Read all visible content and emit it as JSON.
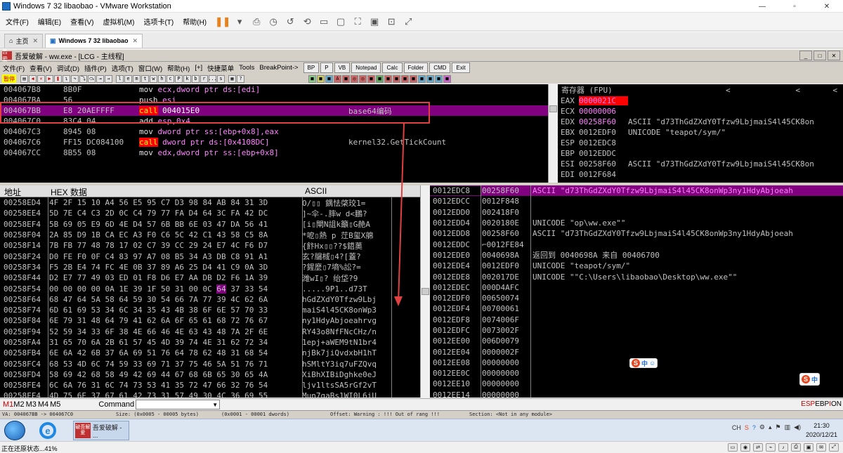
{
  "vm": {
    "title": "Windows 7 32 libaobao - VMware Workstation",
    "window_buttons": [
      "—",
      "▫",
      "✕"
    ],
    "menu": [
      "文件(F)",
      "编辑(E)",
      "查看(V)",
      "虚拟机(M)",
      "选项卡(T)",
      "帮助(H)"
    ],
    "tabs": [
      {
        "label": "主页"
      },
      {
        "label": "Windows 7 32 libaobao"
      }
    ]
  },
  "od": {
    "title": "吾爱破解 - ww.exe - [LCG - 主线程]",
    "icon_text": "吾爱",
    "menu": [
      "文件(F)",
      "查看(V)",
      "调试(D)",
      "插件(P)",
      "选项(T)",
      "窗口(W)",
      "帮助(H)",
      "[+]",
      "快捷菜单",
      "Tools",
      "BreakPoint->"
    ],
    "buttons": [
      "BP",
      "P",
      "VB",
      "Notepad",
      "Calc",
      "Folder",
      "CMD",
      "Exit"
    ],
    "paused": "暂停",
    "tool_letters": [
      "l",
      "e",
      "m",
      "t",
      "w",
      "h",
      "c",
      "P",
      "k",
      "b",
      "r",
      "...",
      "s"
    ]
  },
  "disasm": {
    "rows": [
      {
        "addr": "004067B8",
        "hex": "8B0F",
        "mn": "mov",
        "ops": "ecx,dword ptr ds:[edi]",
        "comment": ""
      },
      {
        "addr": "004067BA",
        "hex": "56",
        "mn": "push",
        "ops": "esi",
        "comment": ""
      },
      {
        "addr": "004067BB",
        "hex": "E8 20AEFFFF",
        "mn": "call",
        "ops": "004015E0",
        "comment": "base64编码",
        "selected": true
      },
      {
        "addr": "004067C0",
        "hex": "83C4 04",
        "mn": "add",
        "ops": "esp,0x4",
        "comment": ""
      },
      {
        "addr": "004067C3",
        "hex": "8945 08",
        "mn": "mov",
        "ops": "dword ptr ss:[ebp+0x8],eax",
        "comment": ""
      },
      {
        "addr": "004067C6",
        "hex": "FF15 DC084100",
        "mn": "call",
        "ops": "dword ptr ds:[0x4108DC]",
        "comment": "kernel32.GetTickCount"
      },
      {
        "addr": "004067CC",
        "hex": "8B55 08",
        "mn": "mov",
        "ops": "edx,dword ptr ss:[ebp+0x8]",
        "comment": ""
      }
    ]
  },
  "registers": {
    "header": "寄存器 (FPU)",
    "rows": [
      {
        "name": "EAX",
        "value": "0000021C",
        "desc": "",
        "style": "hl"
      },
      {
        "name": "ECX",
        "value": "00000006",
        "desc": "",
        "style": "mg"
      },
      {
        "name": "EDX",
        "value": "00258F60",
        "desc": "ASCII \"d73ThGdZXdY0Tfzw9LbjmaiS4l45CK8on",
        "style": "mg"
      },
      {
        "name": "EBX",
        "value": "0012EDF0",
        "desc": "UNICODE \"teapot/sym/\"",
        "style": ""
      },
      {
        "name": "ESP",
        "value": "0012EDC8",
        "desc": "",
        "style": ""
      },
      {
        "name": "EBP",
        "value": "0012EDDC",
        "desc": "",
        "style": ""
      },
      {
        "name": "ESI",
        "value": "00258F60",
        "desc": "ASCII \"d73ThGdZXdY0Tfzw9LbjmaiS4l45CK8on",
        "style": ""
      },
      {
        "name": "EDI",
        "value": "0012F684",
        "desc": "",
        "style": ""
      }
    ]
  },
  "dump": {
    "headers": {
      "addr": "地址",
      "hex": "HEX 数据",
      "ascii": "ASCII"
    },
    "rows": [
      {
        "addr": "00258ED4",
        "hex": "4F 2F 15 10 A4 56 E5 95 C7 D3 98 84 AB 84 31 3D",
        "ascii": "O/▯▯  鍝怯棨珓1="
      },
      {
        "addr": "00258EE4",
        "hex": "5D 7E C4 C3 2D 0C C4 79 77 FA D4 64 3C FA 42 DC",
        "ascii": "]~伞-.膟w  d<鵬?"
      },
      {
        "addr": "00258EF4",
        "hex": "5B 69 05 E9 6D 4E D4 57 6B BB 6E 03 47 DA 56 41",
        "ascii": "[i▯閘N詛k籲▯G赩A"
      },
      {
        "addr": "00258F04",
        "hex": "2A 85 D9 1B CA EC A3 F0 C6 5C 42 C1 43 58 C5 8A",
        "ascii": "*呝▯熱 p 茳B玺X艊"
      },
      {
        "addr": "00258F14",
        "hex": "7B FB 77 48 78 17 02 C7 39 CC 29 24 E7 4C F6 D7",
        "ascii": "{飰Hx▯▯??$鍣薁"
      },
      {
        "addr": "00258F24",
        "hex": "D0 FE F0 0F C4 83 97 A7 08 B5 34 A3 DB C8 91 A1",
        "ascii": "玄?牖棫▯4?[蓋?"
      },
      {
        "addr": "00258F34",
        "hex": "F5 2B E4 74 FC 4E 0B 37 89 A6 25 D4 41 C9 0A 3D",
        "ascii": "?鍟麼▯7墒%訟?="
      },
      {
        "addr": "00258F44",
        "hex": "D2 E7 77 49 03 ED 01 F8 D6 E7 AA DB D2 F6 1A 39",
        "ascii": "潍wI▯?  绐垈?9"
      },
      {
        "addr": "00258F54",
        "hex": "00 00 00 00 0A 1E 39 1F 50 31 00 0C 64 37 33 54",
        "ascii": ".....9P1..d73T"
      },
      {
        "addr": "00258F64",
        "hex": "68 47 64 5A 58 64 59 30 54 66 7A 77 39 4C 62 6A",
        "ascii": "hGdZXdY0Tfzw9Lbj"
      },
      {
        "addr": "00258F74",
        "hex": "6D 61 69 53 34 6C 34 35 43 4B 38 6F 6E 57 70 33",
        "ascii": "maiS4l45CK8onWp3"
      },
      {
        "addr": "00258F84",
        "hex": "6E 79 31 48 64 79 41 62 6A 6F 65 61 68 72 76 67",
        "ascii": "ny1HdyAbjoeahrvg"
      },
      {
        "addr": "00258F94",
        "hex": "52 59 34 33 6F 38 4E 66 46 4E 63 43 48 7A 2F 6E",
        "ascii": "RY43o8NfFNcCHz/n"
      },
      {
        "addr": "00258FA4",
        "hex": "31 65 70 6A 2B 61 57 45 4D 39 74 4E 31 62 72 34",
        "ascii": "1epj+aWEM9tN1br4"
      },
      {
        "addr": "00258FB4",
        "hex": "6E 6A 42 6B 37 6A 69 51 76 64 78 62 48 31 68 54",
        "ascii": "njBk7jiQvdxbH1hT"
      },
      {
        "addr": "00258FC4",
        "hex": "68 53 4D 6C 74 59 33 69 71 37 75 46 5A 51 76 71",
        "ascii": "hSMltY3iq7uFZQvq"
      },
      {
        "addr": "00258FD4",
        "hex": "58 69 42 68 58 49 42 69 44 67 68 6B 65 30 65 4A",
        "ascii": "XiBhXIBiDghke0eJ"
      },
      {
        "addr": "00258FE4",
        "hex": "6C 6A 76 31 6C 74 73 53 41 35 72 47 66 32 76 54",
        "ascii": "ljv1ltsSA5rGf2vT"
      },
      {
        "addr": "00258FF4",
        "hex": "4D 75 6E 37 67 61 42 73 31 57 49 30 4C 36 69 55",
        "ascii": "Mun7gaBs1WI0L6iU"
      }
    ]
  },
  "stack": {
    "rows": [
      {
        "addr": "0012EDC8",
        "value": "00258F60",
        "comment": "ASCII \"d73ThGdZXdY0Tfzw9LbjmaiS4l45CK8onWp3ny1HdyAbjoeah",
        "selected": true
      },
      {
        "addr": "0012EDCC",
        "value": "0012F848",
        "comment": ""
      },
      {
        "addr": "0012EDD0",
        "value": "002418F0",
        "comment": ""
      },
      {
        "addr": "0012EDD4",
        "value": "0020180E",
        "comment": "UNICODE \"op\\ww.exe\"\""
      },
      {
        "addr": "0012EDD8",
        "value": "00258F60",
        "comment": "ASCII \"d73ThGdZXdY0Tfzw9LbjmaiS4l45CK8onWp3ny1HdyAbjoeah"
      },
      {
        "addr": "0012EDDC",
        "value": "⌐0012FE84",
        "comment": ""
      },
      {
        "addr": "0012EDE0",
        "value": "0040698A",
        "comment": "返回到 0040698A 来自 00406700"
      },
      {
        "addr": "0012EDE4",
        "value": "0012EDF0",
        "comment": "UNICODE \"teapot/sym/\""
      },
      {
        "addr": "0012EDE8",
        "value": "002017DE",
        "comment": "UNICODE \"\"C:\\Users\\libaobao\\Desktop\\ww.exe\"\""
      },
      {
        "addr": "0012EDEC",
        "value": "000D4AFC",
        "comment": ""
      },
      {
        "addr": "0012EDF0",
        "value": "00650074",
        "comment": ""
      },
      {
        "addr": "0012EDF4",
        "value": "00700061",
        "comment": ""
      },
      {
        "addr": "0012EDF8",
        "value": "0074006F",
        "comment": ""
      },
      {
        "addr": "0012EDFC",
        "value": "0073002F",
        "comment": ""
      },
      {
        "addr": "0012EE00",
        "value": "006D0079",
        "comment": ""
      },
      {
        "addr": "0012EE04",
        "value": "0000002F",
        "comment": ""
      },
      {
        "addr": "0012EE08",
        "value": "00000000",
        "comment": ""
      },
      {
        "addr": "0012EE0C",
        "value": "00000000",
        "comment": ""
      },
      {
        "addr": "0012EE10",
        "value": "00000000",
        "comment": ""
      },
      {
        "addr": "0012EE14",
        "value": "00000000",
        "comment": ""
      }
    ]
  },
  "ime": {
    "s": "S",
    "zh": "中"
  },
  "cmdbar": {
    "markers": [
      "M1",
      "M2",
      "M3",
      "M4",
      "M5"
    ],
    "command_label": "Command",
    "dropdown_icon": "▼",
    "right_label_red": "ESP",
    "right_label": "EBP",
    "right_label_red2": "I",
    "right_label2": "ON"
  },
  "status": {
    "left": "VA: 004067BB -> 004067C0",
    "size": "Size: (0x0005 - 00005 bytes)",
    "dwords": "(0x0001 - 00001 dwords)",
    "offset": "Offset: Warning : !!! Out of rang !!!",
    "section": "Section: <Not in any module>"
  },
  "taskbar": {
    "od_label": "吾爱破解 - ...",
    "od_icon": "破吾解爱",
    "ie": "e",
    "tray_lang": "CH",
    "time": "21:30",
    "date": "2020/12/21"
  },
  "host": {
    "status": "正在还原状态...41%"
  }
}
